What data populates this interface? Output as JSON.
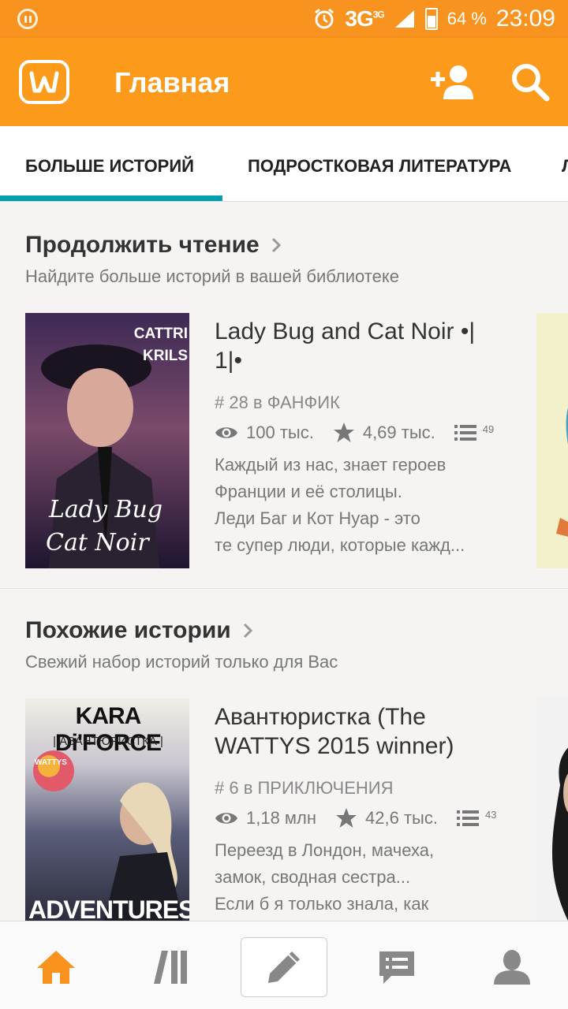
{
  "status_bar": {
    "network": "3G",
    "network_super": "3G",
    "battery": "64 %",
    "time": "23:09"
  },
  "app_bar": {
    "title": "Главная"
  },
  "tabs": [
    {
      "label": "БОЛЬШЕ ИСТОРИЙ",
      "active": true
    },
    {
      "label": "ПОДРОСТКОВАЯ ЛИТЕРАТУРА",
      "active": false
    },
    {
      "label": "Л",
      "active": false
    }
  ],
  "sections": [
    {
      "title": "Продолжить чтение",
      "subtitle": "Найдите больше историй в вашей библиотеке",
      "book": {
        "title": "Lady Bug and Cat Noir •| 1|•",
        "rank": "# 28 в ФАНФИК",
        "reads": "100 тыс.",
        "votes": "4,69 тыс.",
        "parts": "49",
        "description": "Каждый из нас, знает героев\nФранции и  её столицы.\nЛеди Баг  и Кот Нуар - это\nте супер люди, которые кажд...",
        "cover_text_top": "CATTRI",
        "cover_text_top2": "KRILS",
        "cover_text_bottom": "Lady Bug",
        "cover_text_bottom2": "Cat Noir"
      }
    },
    {
      "title": "Похожие истории",
      "subtitle": "Свежий набор историй только для Вас",
      "book": {
        "title": "Авантюристка (The WATTYS 2015 winner)",
        "rank": "# 6 в ПРИКЛЮЧЕНИЯ",
        "reads": "1,18 млн",
        "votes": "42,6 тыс.",
        "parts": "43",
        "description": "Переезд в Лондон, мачеха,\nзамок, сводная сестра...\nЕсли б я только знала, как",
        "cover_author": "KARA Di'FORCE",
        "cover_subtitle": "| АВАНТЮРИСТКА |",
        "cover_badge": "WATTYS",
        "cover_bottom": "ADVENTURESS"
      }
    }
  ],
  "colors": {
    "brand": "#fc9a1c",
    "tab_accent": "#00a0b0",
    "nav_active": "#f7931e"
  }
}
